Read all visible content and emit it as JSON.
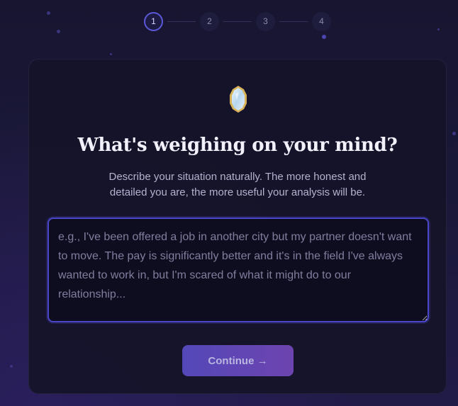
{
  "stepper": {
    "steps": [
      "1",
      "2",
      "3",
      "4"
    ],
    "active_index": 0
  },
  "card": {
    "icon": "mirror-icon",
    "title": "What's weighing on your mind?",
    "subtitle": "Describe your situation naturally. The more honest and detailed you are, the more useful your analysis will be.",
    "textarea": {
      "value": "",
      "placeholder": "e.g., I've been offered a job in another city but my partner doesn't want to move. The pay is significantly better and it's in the field I've always wanted to work in, but I'm scared of what it might do to our relationship..."
    },
    "continue_label": "Continue →"
  },
  "colors": {
    "accent": "#4a46c7",
    "button_start": "#5448b8",
    "button_end": "#6d44b0",
    "mirror_gold": "#d8b35a"
  }
}
